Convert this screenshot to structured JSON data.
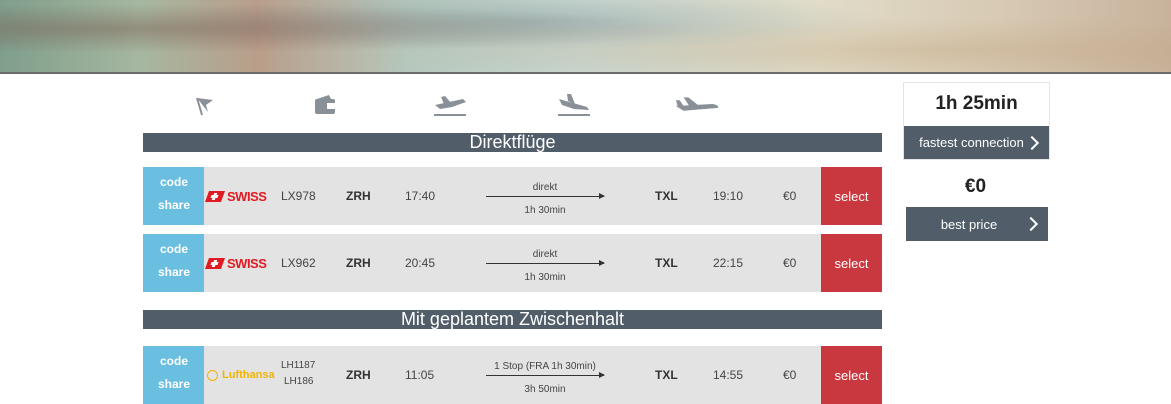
{
  "header": {
    "banner": "decorative-hero-image"
  },
  "filter_icons": [
    {
      "icon": "flag-icon"
    },
    {
      "icon": "wallet-icon"
    },
    {
      "icon": "plane-takeoff-icon"
    },
    {
      "icon": "plane-landing-icon"
    },
    {
      "icon": "plane-icon"
    }
  ],
  "sections": {
    "direct": {
      "title": "Direktflüge"
    },
    "stopover": {
      "title": "Mit geplantem Zwischenhalt"
    }
  },
  "flights": [
    {
      "codeshare": [
        "code",
        "share"
      ],
      "airline": "SWISS",
      "flight": [
        "LX978"
      ],
      "from": "ZRH",
      "dep": "17:40",
      "via": "direkt",
      "duration": "1h 30min",
      "to": "TXL",
      "arr": "19:10",
      "price": "€0",
      "select": "select"
    },
    {
      "codeshare": [
        "code",
        "share"
      ],
      "airline": "SWISS",
      "flight": [
        "LX962"
      ],
      "from": "ZRH",
      "dep": "20:45",
      "via": "direkt",
      "duration": "1h 30min",
      "to": "TXL",
      "arr": "22:15",
      "price": "€0",
      "select": "select"
    },
    {
      "codeshare": [
        "code",
        "share"
      ],
      "airline": "Lufthansa",
      "flight": [
        "LH1187",
        "LH186"
      ],
      "from": "ZRH",
      "dep": "11:05",
      "via": "1 Stop (FRA 1h 30min)",
      "duration": "3h 50min",
      "to": "TXL",
      "arr": "14:55",
      "price": "€0",
      "select": "select"
    }
  ],
  "sidebar": {
    "fastest": {
      "value": "1h 25min",
      "label": "fastest connection"
    },
    "cheapest": {
      "value": "€0",
      "label": "best price"
    }
  },
  "colors": {
    "bar": "#515d69",
    "codeshare": "#6abfe0",
    "select": "#c9373f",
    "swiss": "#e01b22",
    "lufthansa": "#f2b400"
  }
}
